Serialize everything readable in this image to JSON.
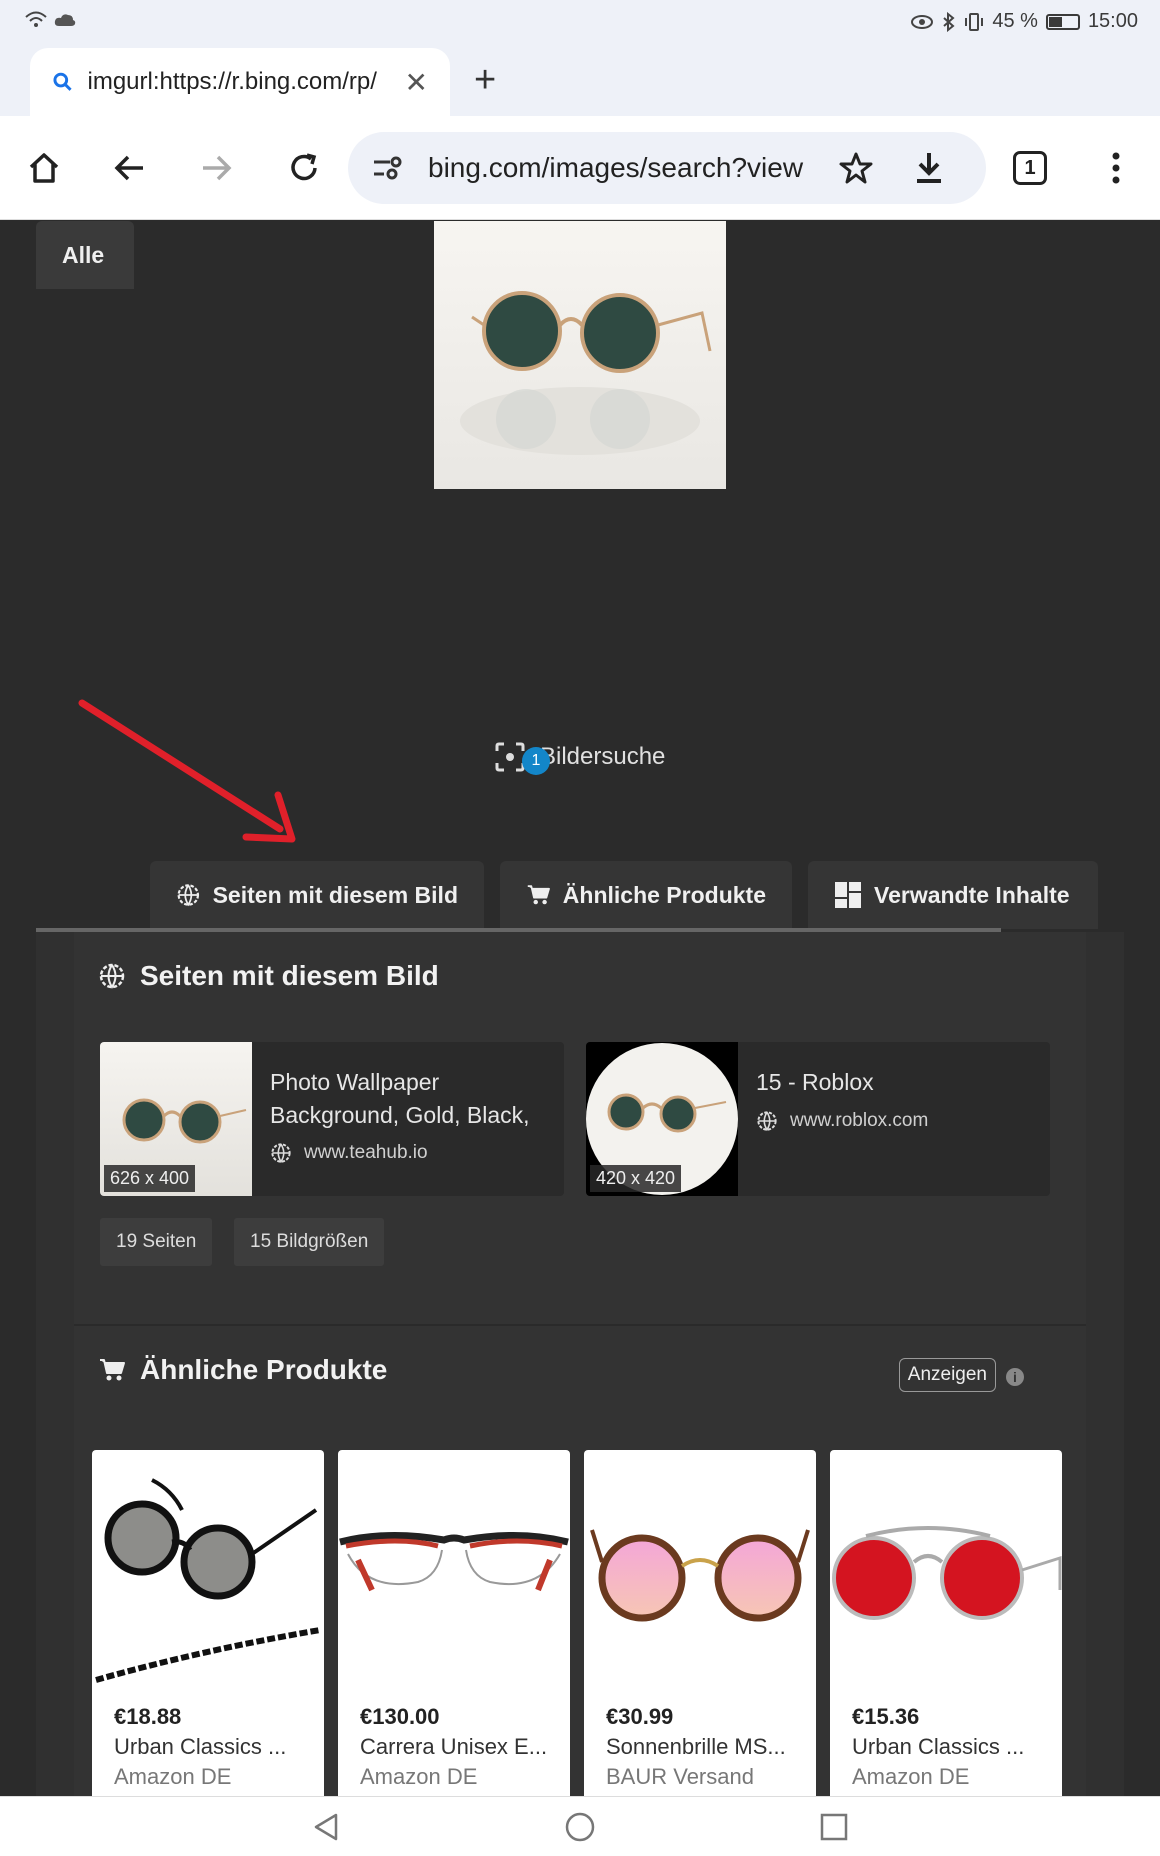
{
  "status_bar": {
    "battery": "45 %",
    "time": "15:00"
  },
  "browser": {
    "tab_title": "imgurl:https://r.bing.com/rp/",
    "url": "bing.com/images/search?view",
    "tab_count": "1"
  },
  "visual_search": {
    "label": "Bildersuche",
    "badge": "1"
  },
  "tabs": [
    {
      "label": "Alle",
      "icon": "none"
    },
    {
      "label": "Seiten mit diesem Bild",
      "icon": "globe-icon"
    },
    {
      "label": "Ähnliche Produkte",
      "icon": "cart-icon"
    },
    {
      "label": "Verwandte Inhalte",
      "icon": "grid-icon"
    }
  ],
  "pages_section": {
    "title": "Seiten mit diesem Bild",
    "results": [
      {
        "title": "Photo Wallpaper Background, Gold, Black,",
        "domain": "www.teahub.io",
        "size": "626 x 400"
      },
      {
        "title": "15 - Roblox",
        "domain": "www.roblox.com",
        "size": "420 x 420"
      }
    ],
    "chips": [
      "19 Seiten",
      "15 Bildgrößen"
    ]
  },
  "products_section": {
    "title": "Ähnliche Produkte",
    "ads_label": "Anzeigen",
    "info": "i",
    "products": [
      {
        "price": "€18.88",
        "name": "Urban Classics ...",
        "seller": "Amazon DE"
      },
      {
        "price": "€130.00",
        "name": "Carrera Unisex E...",
        "seller": "Amazon DE"
      },
      {
        "price": "€30.99",
        "name": "Sonnenbrille MS...",
        "seller": "BAUR Versand"
      },
      {
        "price": "€15.36",
        "name": "Urban Classics ...",
        "seller": "Amazon DE"
      }
    ]
  },
  "colors": {
    "accent_arrow": "#e0202a",
    "badge": "#1386c9",
    "page_bg": "#2b2b2b"
  }
}
